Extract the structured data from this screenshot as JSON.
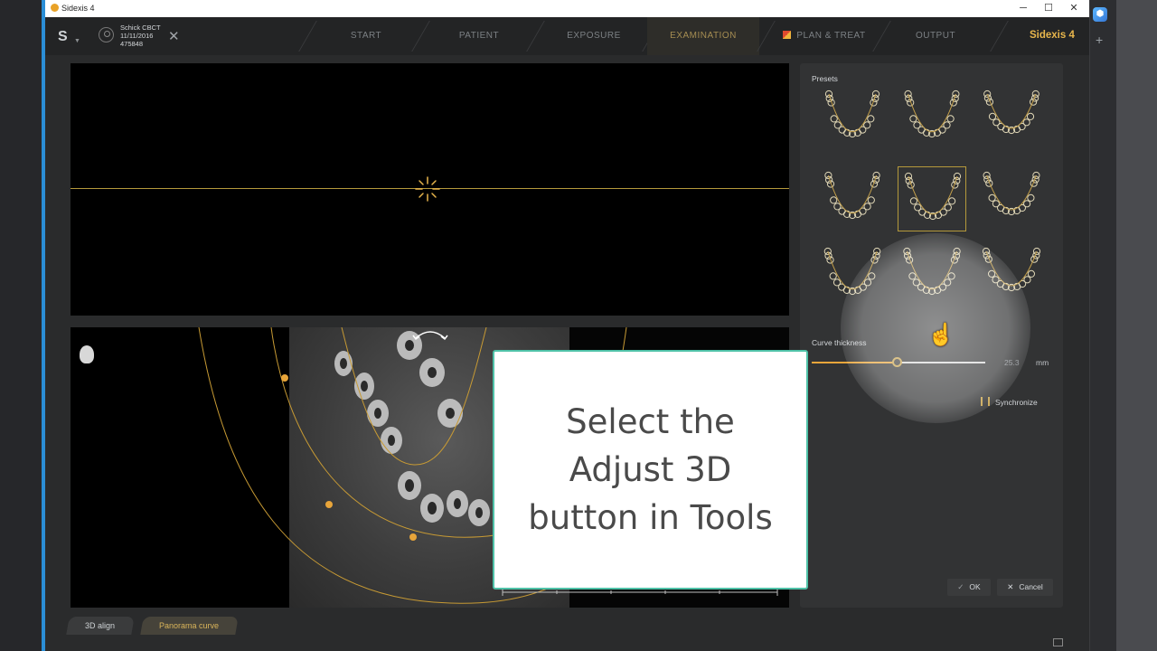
{
  "window": {
    "title": "Sidexis 4",
    "controls": [
      "─",
      "☐",
      "✕"
    ]
  },
  "patient": {
    "name": "Schick CBCT",
    "date": "11/11/2016",
    "id": "475848",
    "close_icon": "✕"
  },
  "nav": {
    "items": [
      {
        "label": "START"
      },
      {
        "label": "PATIENT"
      },
      {
        "label": "EXPOSURE"
      },
      {
        "label": "EXAMINATION"
      },
      {
        "label": "PLAN & TREAT"
      },
      {
        "label": "OUTPUT"
      }
    ],
    "active_index": 3,
    "brand": "Sidexis 4"
  },
  "panel": {
    "presets_label": "Presets",
    "presets_count": 9,
    "selected_preset_index": 4,
    "curve_thickness_label": "Curve thickness",
    "curve_thickness_value": "25.3",
    "curve_thickness_fraction": 0.49,
    "curve_thickness_unit": "mm",
    "synchronize_label": "Synchronize",
    "ok_label": "OK",
    "cancel_label": "Cancel"
  },
  "tabs": [
    {
      "label": "3D align"
    },
    {
      "label": "Panorama curve"
    }
  ],
  "overlay": {
    "text": "Select the\nAdjust 3D\nbutton in Tools"
  },
  "colors": {
    "accent_gold": "#e8b64c",
    "curve_line": "#b5993b",
    "card_border": "#4fc2a8",
    "taskbar_accent": "#2b8ed6"
  },
  "icons": {
    "brand": "sidexis-s-logo",
    "avatar": "patient-avatar-icon",
    "rotate": "rotate-arrow-icon",
    "cursor": "hand-pointer-icon"
  }
}
